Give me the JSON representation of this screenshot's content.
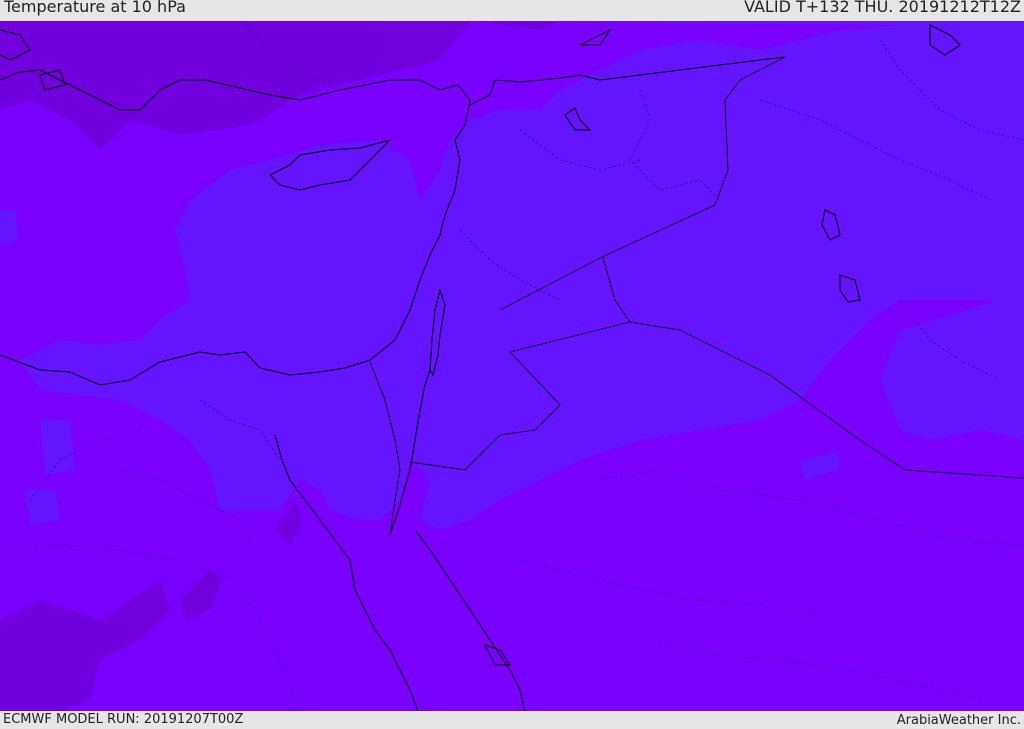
{
  "header": {
    "title": "Temperature at 10 hPa",
    "valid": "VALID T+132 THU. 20191212T12Z"
  },
  "footer": {
    "model_run": "ECMWF MODEL RUN: 20191207T00Z",
    "credit": "ArabiaWeather Inc."
  },
  "map": {
    "variable": "temperature",
    "level_hpa": 10,
    "colors": {
      "base": "#7a00ff",
      "cool_band": "#6414ff",
      "warm_patch": "#7000d8",
      "coastline": "#000000",
      "border": "#1a0033"
    }
  }
}
